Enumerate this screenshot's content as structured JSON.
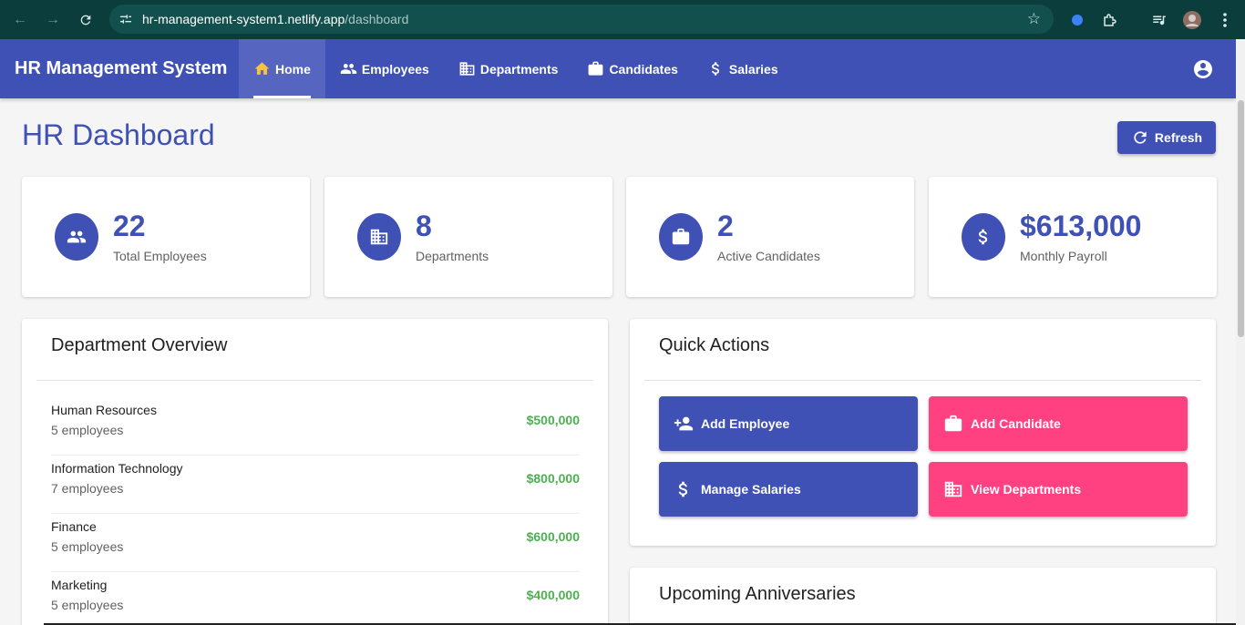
{
  "browser": {
    "url_host": "hr-management-system1.netlify.app",
    "url_path": "/dashboard"
  },
  "app": {
    "title": "HR Management System",
    "nav": [
      {
        "label": "Home",
        "icon": "home-icon",
        "active": true
      },
      {
        "label": "Employees",
        "icon": "people-icon",
        "active": false
      },
      {
        "label": "Departments",
        "icon": "building-icon",
        "active": false
      },
      {
        "label": "Candidates",
        "icon": "briefcase-icon",
        "active": false
      },
      {
        "label": "Salaries",
        "icon": "dollar-icon",
        "active": false
      }
    ]
  },
  "page": {
    "title": "HR Dashboard",
    "refresh_label": "Refresh"
  },
  "stats": [
    {
      "value": "22",
      "label": "Total Employees",
      "icon": "people-icon"
    },
    {
      "value": "8",
      "label": "Departments",
      "icon": "building-icon"
    },
    {
      "value": "2",
      "label": "Active Candidates",
      "icon": "briefcase-icon"
    },
    {
      "value": "$613,000",
      "label": "Monthly Payroll",
      "icon": "dollar-icon"
    }
  ],
  "department_overview": {
    "title": "Department Overview",
    "rows": [
      {
        "name": "Human Resources",
        "count": "5 employees",
        "budget": "$500,000"
      },
      {
        "name": "Information Technology",
        "count": "7 employees",
        "budget": "$800,000"
      },
      {
        "name": "Finance",
        "count": "5 employees",
        "budget": "$600,000"
      },
      {
        "name": "Marketing",
        "count": "5 employees",
        "budget": "$400,000"
      }
    ]
  },
  "quick_actions": {
    "title": "Quick Actions",
    "buttons": [
      {
        "label": "Add Employee",
        "icon": "person-add-icon"
      },
      {
        "label": "Add Candidate",
        "icon": "briefcase-icon"
      },
      {
        "label": "Manage Salaries",
        "icon": "dollar-icon"
      },
      {
        "label": "View Departments",
        "icon": "building-icon"
      }
    ]
  },
  "anniversaries": {
    "title": "Upcoming Anniversaries"
  },
  "colors": {
    "primary": "#3f51b5",
    "secondary": "#ff4081",
    "success": "#4caf50",
    "browser_chrome": "#0b3d3c"
  }
}
